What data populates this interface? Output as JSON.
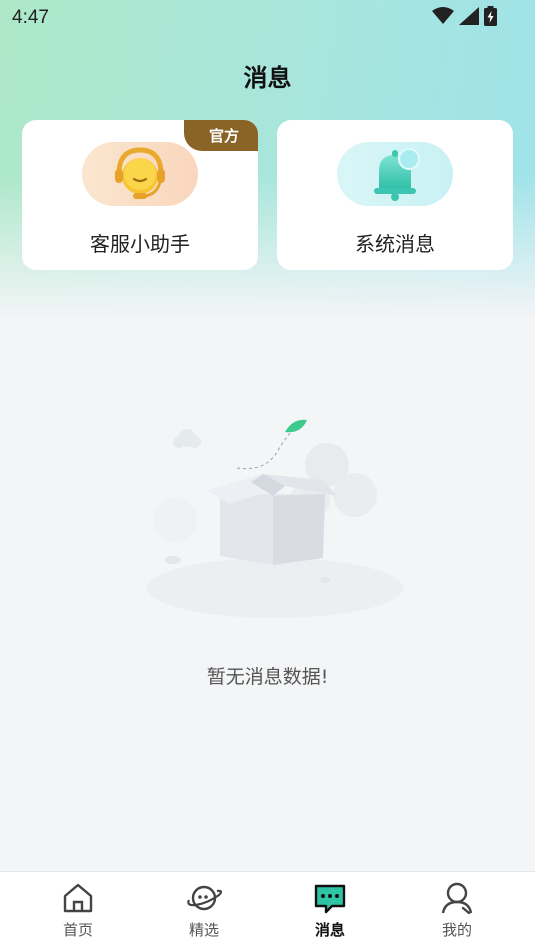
{
  "status_bar": {
    "time": "4:47"
  },
  "header": {
    "title": "消息"
  },
  "cards": [
    {
      "label": "客服小助手",
      "badge": "官方",
      "icon": "headset-emoji-icon"
    },
    {
      "label": "系统消息",
      "icon": "bell-icon"
    }
  ],
  "empty_state": {
    "text": "暂无消息数据!",
    "icon": "empty-box-illustration"
  },
  "tabbar": {
    "items": [
      {
        "label": "首页",
        "icon": "home-icon",
        "active": false
      },
      {
        "label": "精选",
        "icon": "planet-chat-icon",
        "active": false
      },
      {
        "label": "消息",
        "icon": "message-bubble-icon",
        "active": true
      },
      {
        "label": "我的",
        "icon": "user-icon",
        "active": false
      }
    ]
  },
  "colors": {
    "accent": "#2fc4a4",
    "badge": "#8a6426",
    "background": "#f4f5f7"
  }
}
